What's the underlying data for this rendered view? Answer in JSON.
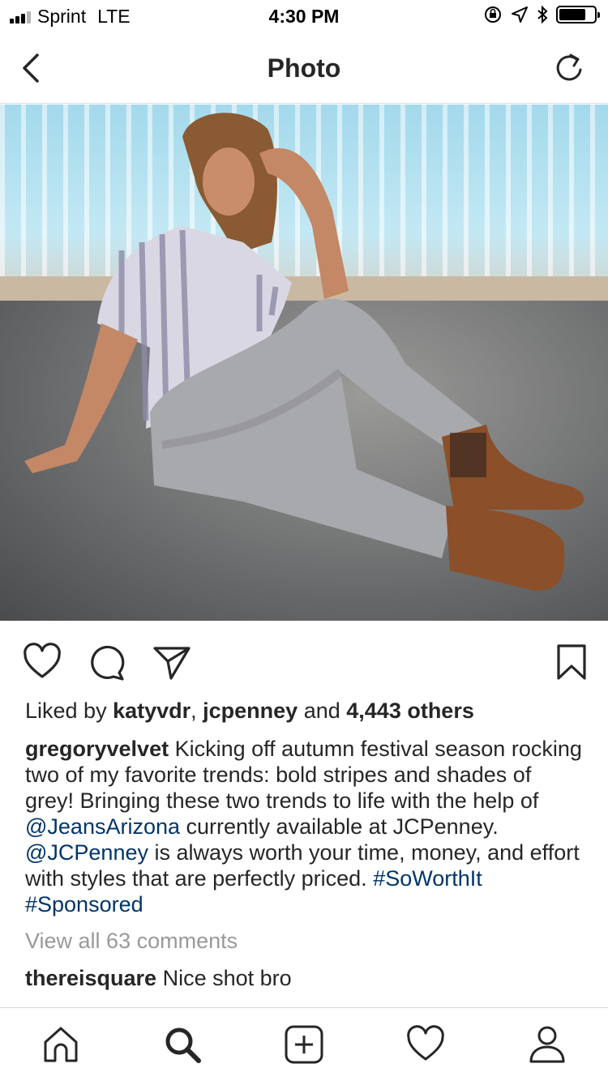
{
  "status_bar": {
    "carrier": "Sprint",
    "network": "LTE",
    "time": "4:30 PM",
    "battery_level": 0.75
  },
  "nav": {
    "title": "Photo",
    "back_icon": "chevron-left-icon",
    "refresh_icon": "refresh-icon"
  },
  "photo": {
    "description_icon": "post-photo"
  },
  "actions": {
    "like_icon": "heart-icon",
    "comment_icon": "comment-icon",
    "share_icon": "send-icon",
    "save_icon": "bookmark-icon"
  },
  "likes": {
    "prefix": "Liked by ",
    "user1": "katyvdr",
    "sep": ", ",
    "user2": "jcpenney",
    "and": " and ",
    "others": "4,443 others"
  },
  "caption": {
    "username": "gregoryvelvet",
    "text1": " Kicking off autumn festival season rocking two of my favorite trends: bold stripes and shades of grey! Bringing these two trends to life with the help of ",
    "mention1": "@JeansArizona",
    "text2": " currently available at JCPenney. ",
    "mention2": "@JCPenney",
    "text3": " is always worth your time, money, and effort with styles that are perfectly priced. ",
    "hashtag1": "#SoWorthIt",
    "space": " ",
    "hashtag2": "#Sponsored"
  },
  "comments": {
    "view_all": "View all 63 comments",
    "first_user": "thereisquare",
    "first_text": " Nice shot bro"
  },
  "tab_bar": {
    "home_icon": "home-icon",
    "search_icon": "search-icon",
    "add_icon": "add-post-icon",
    "activity_icon": "heart-icon",
    "profile_icon": "profile-icon"
  },
  "colors": {
    "link": "#003569",
    "muted": "#999999",
    "text": "#262626",
    "divider": "#dbdbdb"
  }
}
